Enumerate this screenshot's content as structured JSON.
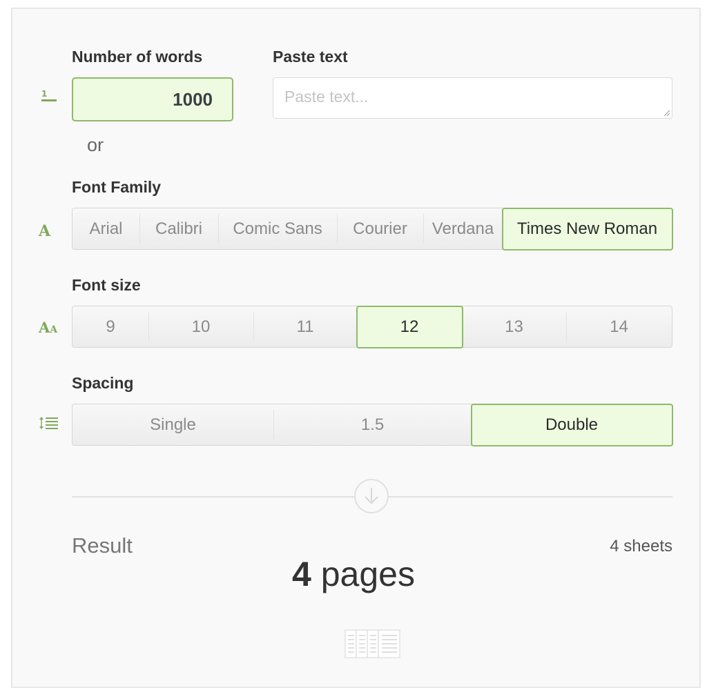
{
  "words": {
    "label": "Number of words",
    "value": "1000",
    "icon": "word-count-icon"
  },
  "or_text": "or",
  "paste": {
    "label": "Paste text",
    "placeholder": "Paste text..."
  },
  "font_family": {
    "label": "Font Family",
    "icon": "font-letter-icon",
    "options": [
      "Arial",
      "Calibri",
      "Comic Sans",
      "Courier",
      "Verdana",
      "Times New Roman"
    ],
    "selected": "Times New Roman"
  },
  "font_size": {
    "label": "Font size",
    "icon": "font-size-icon",
    "options": [
      "9",
      "10",
      "11",
      "12",
      "13",
      "14"
    ],
    "selected": "12"
  },
  "spacing": {
    "label": "Spacing",
    "icon": "line-spacing-icon",
    "options": [
      "Single",
      "1.5",
      "Double"
    ],
    "selected": "Double"
  },
  "result": {
    "label": "Result",
    "sheets": "4 sheets",
    "pages_number": "4",
    "pages_unit": "pages"
  },
  "colors": {
    "accent": "#8dbb6a",
    "selected_bg": "#eefbe0"
  }
}
